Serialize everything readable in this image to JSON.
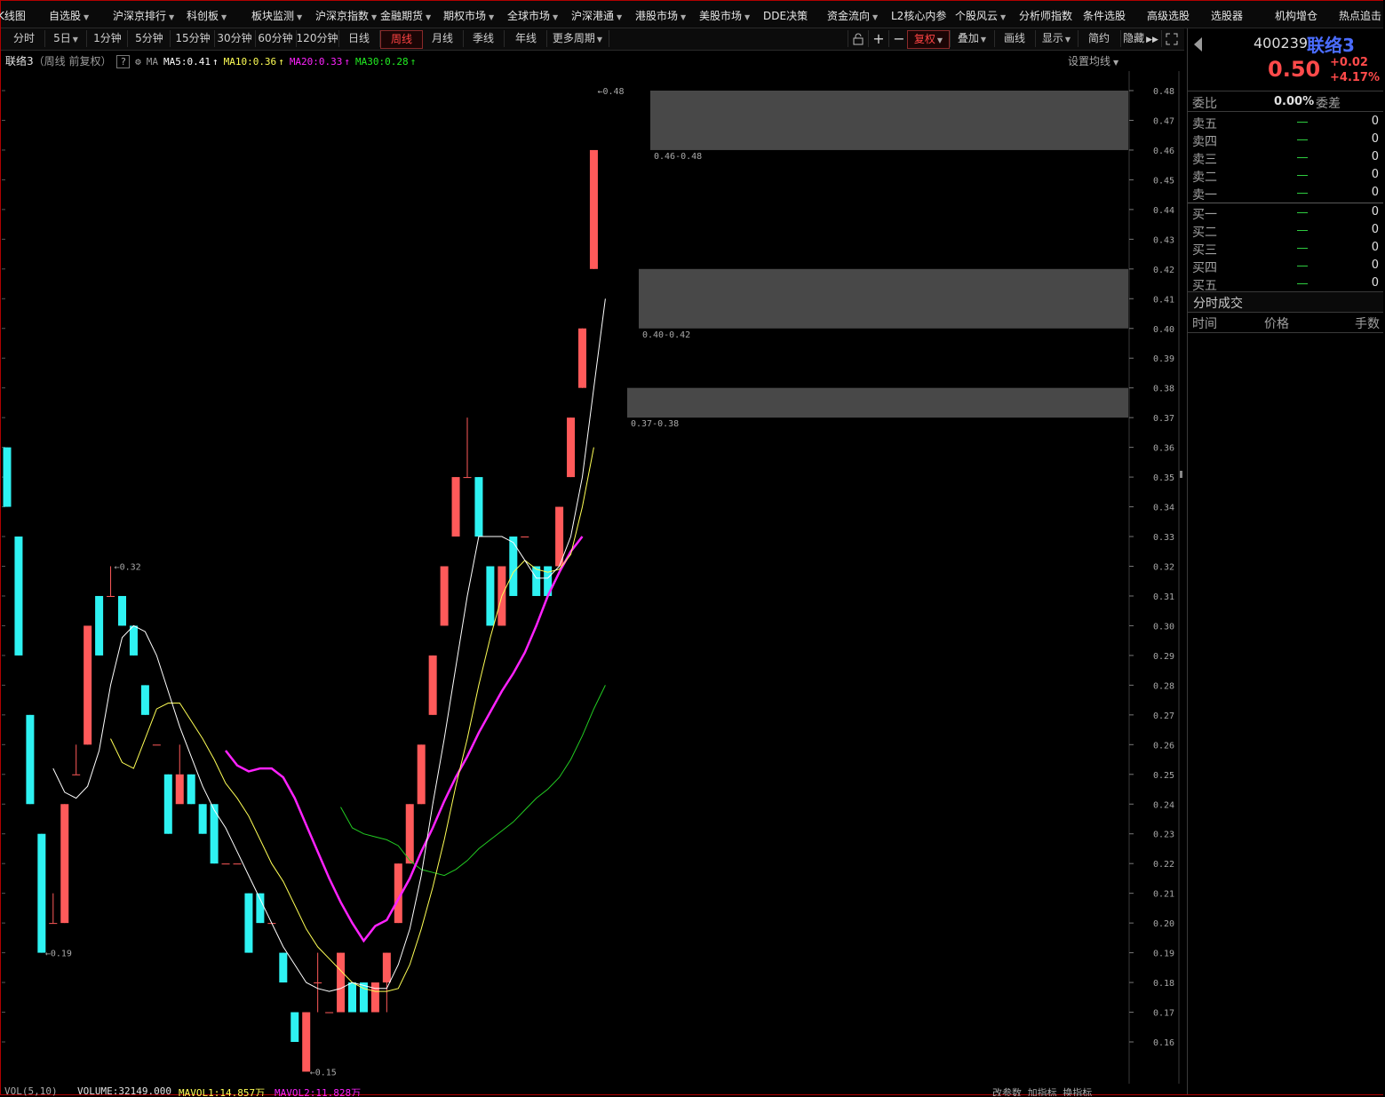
{
  "menu": [
    {
      "label": "K线图",
      "caret": false
    },
    {
      "label": "自选股",
      "caret": true
    },
    {
      "label": "沪深京排行",
      "caret": true
    },
    {
      "label": "科创板",
      "caret": true
    },
    {
      "label": "板块监测",
      "caret": true
    },
    {
      "label": "沪深京指数",
      "caret": true
    },
    {
      "label": "金融期货",
      "caret": true
    },
    {
      "label": "期权市场",
      "caret": true
    },
    {
      "label": "全球市场",
      "caret": true
    },
    {
      "label": "沪深港通",
      "caret": true
    },
    {
      "label": "港股市场",
      "caret": true
    },
    {
      "label": "美股市场",
      "caret": true
    },
    {
      "label": "DDE决策",
      "caret": false
    },
    {
      "label": "资金流向",
      "caret": true
    },
    {
      "label": "L2核心内参",
      "caret": false
    },
    {
      "label": "个股风云",
      "caret": true
    },
    {
      "label": "分析师指数",
      "caret": false
    },
    {
      "label": "条件选股",
      "caret": false
    },
    {
      "label": "高级选股",
      "caret": false
    },
    {
      "label": "选股器",
      "caret": false
    },
    {
      "label": "机构增仓",
      "caret": false
    },
    {
      "label": "热点追击",
      "caret": false
    }
  ],
  "periods": [
    {
      "label": "分时",
      "caret": false
    },
    {
      "label": "5日",
      "caret": true
    },
    {
      "label": "1分钟",
      "caret": false
    },
    {
      "label": "5分钟",
      "caret": false
    },
    {
      "label": "15分钟",
      "caret": false
    },
    {
      "label": "30分钟",
      "caret": false
    },
    {
      "label": "60分钟",
      "caret": false
    },
    {
      "label": "120分钟",
      "caret": false
    },
    {
      "label": "日线",
      "caret": false
    },
    {
      "label": "周线",
      "caret": false,
      "active": true
    },
    {
      "label": "月线",
      "caret": false
    },
    {
      "label": "季线",
      "caret": false
    },
    {
      "label": "年线",
      "caret": false
    },
    {
      "label": "更多周期",
      "caret": true
    }
  ],
  "toolbar": {
    "lock_icon": "lock-icon",
    "plus_icon": "plus-icon",
    "minus_icon": "minus-icon",
    "fuquan": "复权",
    "overlay": "叠加",
    "draw": "画线",
    "display": "显示",
    "simple": "简约",
    "hide": "隐藏",
    "expand_icon": "expand-icon"
  },
  "info": {
    "stock": "联络3",
    "mode": "（周线 前复权）",
    "help": "?",
    "gear_icon": "gear-icon",
    "ma_label": "MA",
    "ma5": "MA5:0.41",
    "ma10": "MA10:0.36",
    "ma20": "MA20:0.33",
    "ma30": "MA30:0.28",
    "set_ma": "设置均线"
  },
  "colors": {
    "up": "#ff5a5a",
    "down": "#2ef2f2",
    "ma5": "#ffffff",
    "ma10": "#ffff55",
    "ma20": "#ff22ff",
    "ma30": "#22cc22",
    "zone": "#484848"
  },
  "chart_data": {
    "type": "candlestick",
    "y_ticks": [
      "0.48",
      "0.47",
      "0.46",
      "0.45",
      "0.44",
      "0.43",
      "0.42",
      "0.41",
      "0.40",
      "0.39",
      "0.38",
      "0.37",
      "0.36",
      "0.35",
      "0.34",
      "0.33",
      "0.32",
      "0.31",
      "0.30",
      "0.29",
      "0.28",
      "0.27",
      "0.26",
      "0.25",
      "0.24",
      "0.23",
      "0.22",
      "0.21",
      "0.20",
      "0.19",
      "0.18",
      "0.17",
      "0.16"
    ],
    "ylim": [
      0.15,
      0.485
    ],
    "candles": [
      [
        0.36,
        0.36,
        0.34,
        0.34
      ],
      [
        0.33,
        0.33,
        0.29,
        0.29
      ],
      [
        0.27,
        0.27,
        0.24,
        0.24
      ],
      [
        0.23,
        0.23,
        0.19,
        0.19
      ],
      [
        0.2,
        0.21,
        0.2,
        0.2
      ],
      [
        0.2,
        0.24,
        0.2,
        0.24
      ],
      [
        0.25,
        0.26,
        0.25,
        0.25
      ],
      [
        0.26,
        0.3,
        0.26,
        0.3
      ],
      [
        0.31,
        0.31,
        0.29,
        0.29
      ],
      [
        0.31,
        0.32,
        0.31,
        0.31
      ],
      [
        0.31,
        0.31,
        0.3,
        0.3
      ],
      [
        0.3,
        0.3,
        0.29,
        0.29
      ],
      [
        0.28,
        0.28,
        0.27,
        0.27
      ],
      [
        0.26,
        0.26,
        0.26,
        0.26
      ],
      [
        0.25,
        0.25,
        0.23,
        0.23
      ],
      [
        0.24,
        0.26,
        0.25,
        0.25
      ],
      [
        0.25,
        0.25,
        0.24,
        0.24
      ],
      [
        0.24,
        0.24,
        0.23,
        0.23
      ],
      [
        0.24,
        0.24,
        0.22,
        0.22
      ],
      [
        0.22,
        0.22,
        0.22,
        0.22
      ],
      [
        0.22,
        0.22,
        0.22,
        0.22
      ],
      [
        0.21,
        0.21,
        0.19,
        0.19
      ],
      [
        0.21,
        0.21,
        0.2,
        0.2
      ],
      [
        0.2,
        0.2,
        0.2,
        0.2
      ],
      [
        0.19,
        0.19,
        0.18,
        0.18
      ],
      [
        0.17,
        0.17,
        0.16,
        0.16
      ],
      [
        0.15,
        0.17,
        0.15,
        0.17
      ],
      [
        0.18,
        0.19,
        0.17,
        0.18
      ],
      [
        0.17,
        0.17,
        0.17,
        0.17
      ],
      [
        0.17,
        0.19,
        0.18,
        0.19
      ],
      [
        0.18,
        0.18,
        0.17,
        0.17
      ],
      [
        0.18,
        0.18,
        0.17,
        0.17
      ],
      [
        0.17,
        0.17,
        0.17,
        0.18
      ],
      [
        0.18,
        0.19,
        0.17,
        0.19
      ],
      [
        0.2,
        0.22,
        0.2,
        0.22
      ],
      [
        0.22,
        0.24,
        0.22,
        0.24
      ],
      [
        0.24,
        0.26,
        0.24,
        0.26
      ],
      [
        0.27,
        0.29,
        0.27,
        0.29
      ],
      [
        0.3,
        0.32,
        0.3,
        0.32
      ],
      [
        0.33,
        0.35,
        0.33,
        0.35
      ],
      [
        0.35,
        0.37,
        0.35,
        0.35
      ],
      [
        0.35,
        0.35,
        0.33,
        0.33
      ],
      [
        0.32,
        0.32,
        0.3,
        0.3
      ],
      [
        0.3,
        0.32,
        0.3,
        0.32
      ],
      [
        0.33,
        0.33,
        0.31,
        0.31
      ],
      [
        0.33,
        0.33,
        0.33,
        0.33
      ],
      [
        0.32,
        0.32,
        0.31,
        0.31
      ],
      [
        0.32,
        0.32,
        0.31,
        0.31
      ],
      [
        0.32,
        0.34,
        0.32,
        0.34
      ],
      [
        0.35,
        0.37,
        0.35,
        0.37
      ],
      [
        0.38,
        0.4,
        0.38,
        0.4
      ],
      [
        0.42,
        0.46,
        0.42,
        0.46
      ]
    ],
    "ma5": [
      null,
      null,
      null,
      null,
      0.252,
      0.244,
      0.242,
      0.246,
      0.258,
      0.28,
      0.296,
      0.3,
      0.298,
      0.29,
      0.278,
      0.266,
      0.256,
      0.246,
      0.238,
      0.232,
      0.224,
      0.216,
      0.208,
      0.2,
      0.192,
      0.186,
      0.18,
      0.178,
      0.177,
      0.178,
      0.18,
      0.179,
      0.178,
      0.178,
      0.186,
      0.198,
      0.216,
      0.24,
      0.262,
      0.286,
      0.31,
      0.33,
      0.33,
      0.33,
      0.328,
      0.322,
      0.316,
      0.316,
      0.32,
      0.33,
      0.35,
      0.38,
      0.41
    ],
    "ma10": [
      null,
      null,
      null,
      null,
      null,
      null,
      null,
      null,
      null,
      0.262,
      0.254,
      0.252,
      0.262,
      0.272,
      0.274,
      0.274,
      0.268,
      0.262,
      0.255,
      0.247,
      0.242,
      0.236,
      0.228,
      0.22,
      0.214,
      0.206,
      0.198,
      0.192,
      0.188,
      0.184,
      0.18,
      0.178,
      0.177,
      0.177,
      0.178,
      0.186,
      0.198,
      0.212,
      0.228,
      0.246,
      0.262,
      0.28,
      0.296,
      0.31,
      0.318,
      0.322,
      0.319,
      0.318,
      0.319,
      0.324,
      0.34,
      0.36
    ],
    "ma20": [
      null,
      null,
      null,
      null,
      null,
      null,
      null,
      null,
      null,
      null,
      null,
      null,
      null,
      null,
      null,
      null,
      null,
      null,
      null,
      0.258,
      0.253,
      0.251,
      0.252,
      0.252,
      0.249,
      0.242,
      0.233,
      0.224,
      0.215,
      0.207,
      0.2,
      0.194,
      0.199,
      0.201,
      0.208,
      0.215,
      0.224,
      0.232,
      0.241,
      0.249,
      0.256,
      0.264,
      0.271,
      0.278,
      0.284,
      0.291,
      0.3,
      0.31,
      0.318,
      0.325,
      0.33
    ],
    "ma30": [
      null,
      null,
      null,
      null,
      null,
      null,
      null,
      null,
      null,
      null,
      null,
      null,
      null,
      null,
      null,
      null,
      null,
      null,
      null,
      null,
      null,
      null,
      null,
      null,
      null,
      null,
      null,
      null,
      null,
      0.239,
      0.232,
      0.23,
      0.229,
      0.228,
      0.226,
      0.221,
      0.218,
      0.217,
      0.216,
      0.218,
      0.221,
      0.225,
      0.228,
      0.231,
      0.234,
      0.238,
      0.242,
      0.245,
      0.249,
      0.255,
      0.263,
      0.272,
      0.28
    ],
    "zones": [
      {
        "low": 0.46,
        "high": 0.48,
        "label": ""
      },
      {
        "low": 0.4,
        "high": 0.42,
        "label": "0.40-0.42"
      },
      {
        "low": 0.37,
        "high": 0.38,
        "label": "0.37-0.38"
      }
    ],
    "zone_top_label": "0.46-0.48",
    "annotations": [
      {
        "label": "0.48",
        "index": 51,
        "price": 0.48
      },
      {
        "label": "0.32",
        "index": 9,
        "price": 0.32
      },
      {
        "label": "0.19",
        "index": 3,
        "price": 0.19
      },
      {
        "label": "0.15",
        "index": 26,
        "price": 0.15
      }
    ]
  },
  "bottom": {
    "vol_prefix": "VOL(5,10)",
    "vol_val": "VOLUME:32149.000",
    "mavol1": "MAVOL1:14.857万",
    "mavol2": "MAVOL2:11.828万",
    "tools": "改参数 加指标 换指标"
  },
  "quote": {
    "code": "400239",
    "name": "联络3",
    "price": "0.50",
    "change": "+0.02",
    "pct": "+4.17%",
    "weibi_label": "委比",
    "weibi_val": "0.00%",
    "weicha_label": "委差",
    "orderbook": [
      {
        "label": "卖五",
        "qty": "0"
      },
      {
        "label": "卖四",
        "qty": "0"
      },
      {
        "label": "卖三",
        "qty": "0"
      },
      {
        "label": "卖二",
        "qty": "0"
      },
      {
        "label": "卖一",
        "qty": "0"
      },
      {
        "label": "买一",
        "qty": "0"
      },
      {
        "label": "买二",
        "qty": "0"
      },
      {
        "label": "买三",
        "qty": "0"
      },
      {
        "label": "买四",
        "qty": "0"
      },
      {
        "label": "买五",
        "qty": "0"
      }
    ],
    "trade_title": "分时成交",
    "col_time": "时间",
    "col_price": "价格",
    "col_vol": "手数"
  }
}
